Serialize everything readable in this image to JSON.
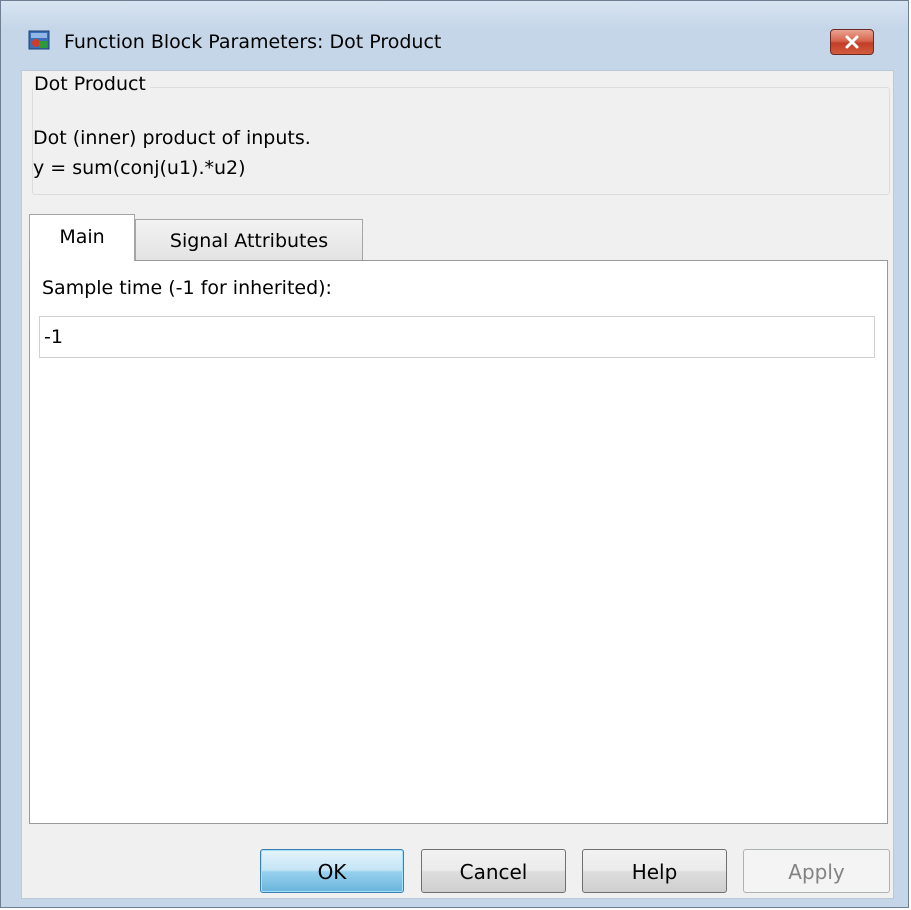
{
  "window": {
    "title": "Function Block Parameters: Dot Product",
    "icon": "simulink-block-icon",
    "close_icon": "close-icon"
  },
  "block": {
    "name": "Dot Product",
    "description_line1": "Dot (inner) product of inputs.",
    "description_line2": "y = sum(conj(u1).*u2)"
  },
  "tabs": [
    {
      "label": "Main",
      "selected": true
    },
    {
      "label": "Signal Attributes",
      "selected": false
    }
  ],
  "main_tab": {
    "sample_time_label": "Sample time (-1 for inherited):",
    "sample_time_value": "-1"
  },
  "buttons": {
    "ok": "OK",
    "cancel": "Cancel",
    "help": "Help",
    "apply": "Apply"
  }
}
